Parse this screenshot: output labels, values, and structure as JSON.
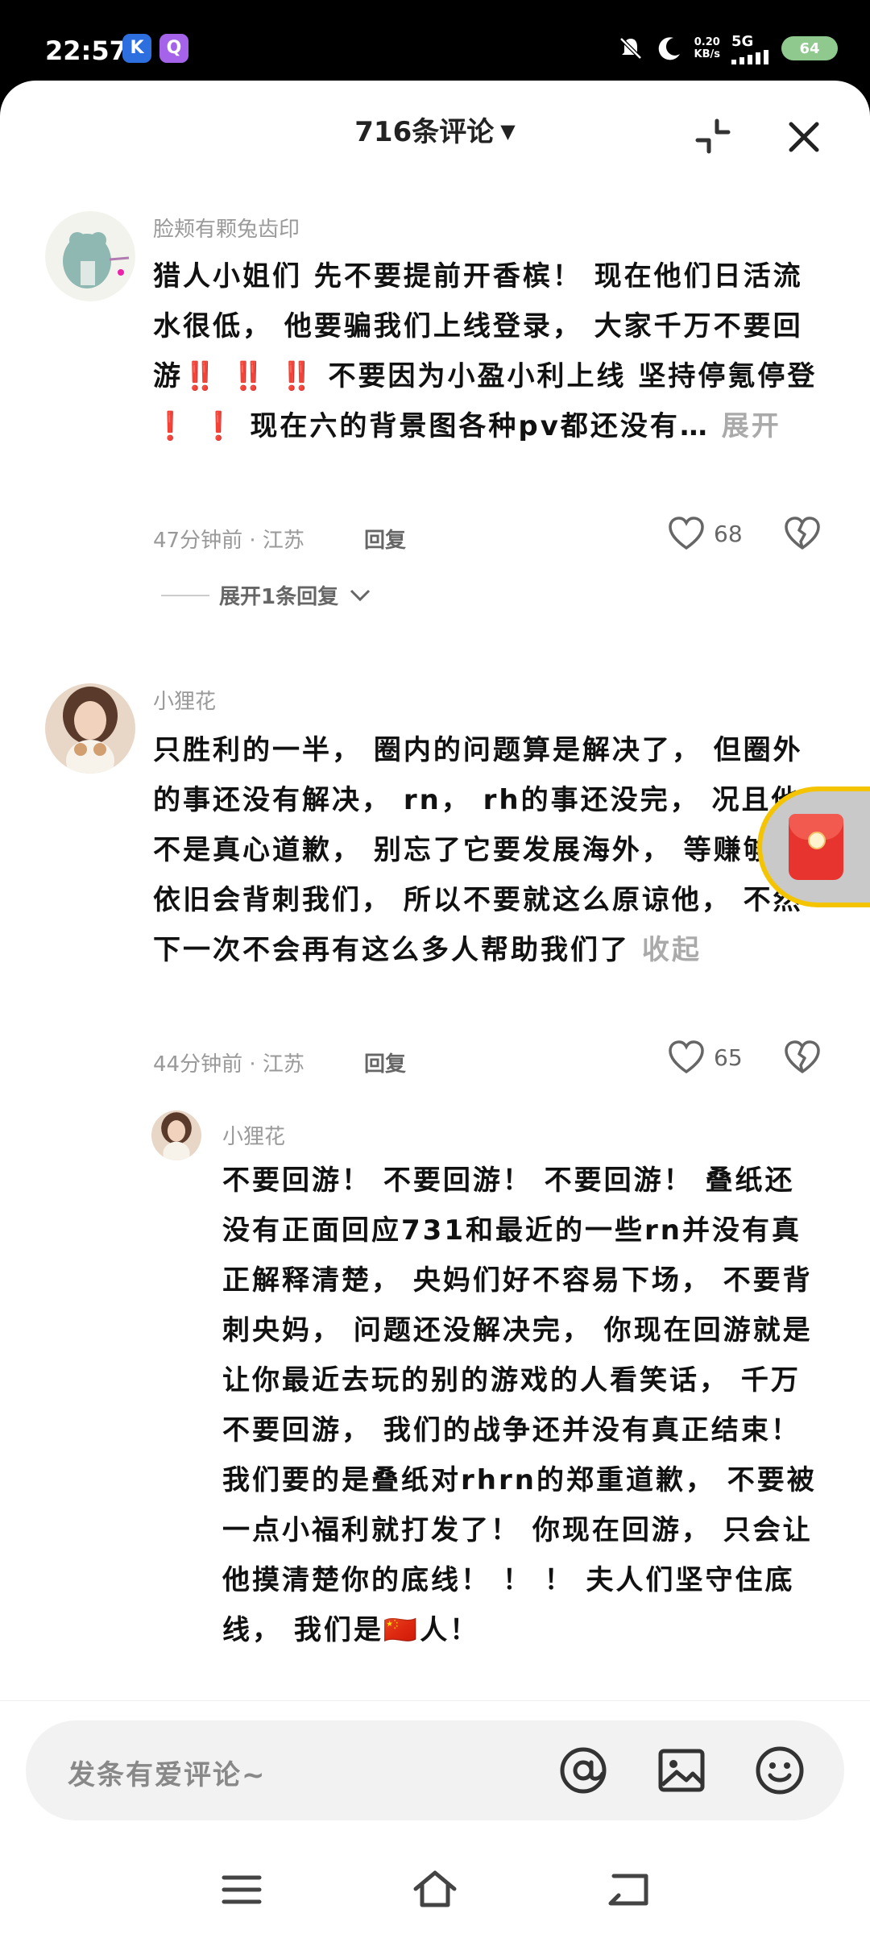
{
  "status_bar": {
    "time": "22:57",
    "app_badges": [
      "K",
      "Q"
    ],
    "net_speed_value": "0.20",
    "net_speed_unit": "KB/s",
    "network": "5G",
    "battery": "64"
  },
  "header": {
    "title": "716条评论"
  },
  "comments": [
    {
      "username": "脸颊有颗兔齿印",
      "text_part1": "猎人小姐们 先不要提前开香槟！ 现在他们日活流水很低， 他要骗我们上线登录， 大家千万不要回游",
      "emoji1": "‼️ ‼️ ‼️",
      "text_part2": "不要因为小盈小利上线 坚持停氪停登",
      "emoji2": "❗ ❗",
      "text_part3": "现在六的背景图各种pv都还没有…",
      "expand_label": "展开",
      "time_location": "47分钟前 · 江苏",
      "reply_label": "回复",
      "likes": "68",
      "expand_replies": "展开1条回复"
    },
    {
      "username": "小狸花",
      "text": "只胜利的一半， 圈内的问题算是解决了， 但圈外的事还没有解决， rn， rh的事还没完， 况且他不是真心道歉， 别忘了它要发展海外， 等赚够钱依旧会背刺我们， 所以不要就这么原谅他， 不然下一次不会再有这么多人帮助我们了",
      "collapse_label": "收起",
      "time_location": "44分钟前 · 江苏",
      "reply_label": "回复",
      "likes": "65"
    }
  ],
  "reply": {
    "username": "小狸花",
    "text": "不要回游！ 不要回游！ 不要回游！ 叠纸还没有正面回应731和最近的一些rn并没有真正解释清楚， 央妈们好不容易下场， 不要背刺央妈， 问题还没解决完， 你现在回游就是让你最近去玩的别的游戏的人看笑话， 千万不要回游， 我们的战争还并没有真正结束！ 我们要的是叠纸对rhrn的郑重道歉， 不要被一点小福利就打发了！ 你现在回游， 只会让他摸清楚你的底线！ ！ ！ 夫人们坚守住底线， 我们是",
    "flag": "🇨🇳",
    "tail": "人！"
  },
  "input_bar": {
    "placeholder": "发条有爱评论~",
    "icons": [
      "at-icon",
      "image-icon",
      "emoji-icon"
    ]
  },
  "nav_bar": {
    "icons": [
      "menu-icon",
      "home-icon",
      "back-icon"
    ]
  },
  "colors": {
    "accent_red": "#e8312c",
    "meta_gray": "#999999",
    "text_black": "#111111"
  }
}
